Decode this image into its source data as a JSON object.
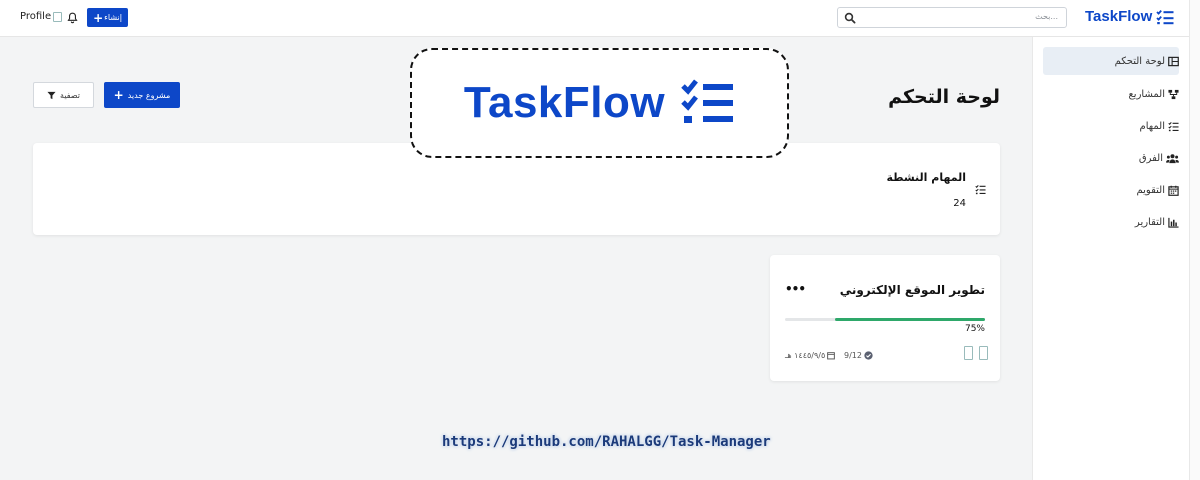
{
  "topbar": {
    "profile_label": "Profile",
    "new_button_label": "إنشاء",
    "search_placeholder": "بحث...",
    "brand": "TaskFlow"
  },
  "sidebar": {
    "items": [
      {
        "label": "لوحة التحكم",
        "icon": "dashboard-icon",
        "active": true
      },
      {
        "label": "المشاريع",
        "icon": "projects-icon",
        "active": false
      },
      {
        "label": "المهام",
        "icon": "tasks-icon",
        "active": false
      },
      {
        "label": "الفرق",
        "icon": "teams-icon",
        "active": false
      },
      {
        "label": "التقويم",
        "icon": "calendar-icon",
        "active": false
      },
      {
        "label": "التقارير",
        "icon": "reports-icon",
        "active": false
      }
    ]
  },
  "main": {
    "page_title": "لوحة التحكم",
    "new_project_label": "مشروع جديد",
    "filter_label": "تصفية",
    "stats": {
      "active_tasks_label": "المهام النشطة",
      "active_tasks_value": "24"
    },
    "project_card": {
      "title": "تطوير الموقع الإلكتروني",
      "progress_percent": 75,
      "progress_label": "75%",
      "tasks_count": "9/12",
      "due_date": "١٤٤٥/٩/٥ هـ"
    }
  },
  "overlay": {
    "logo_text": "TaskFlow",
    "repo_url": "https://github.com/RAHALGG/Task-Manager"
  },
  "colors": {
    "accent": "#0d47c8",
    "progress": "#2ea86a",
    "background": "#f3f4f5"
  }
}
